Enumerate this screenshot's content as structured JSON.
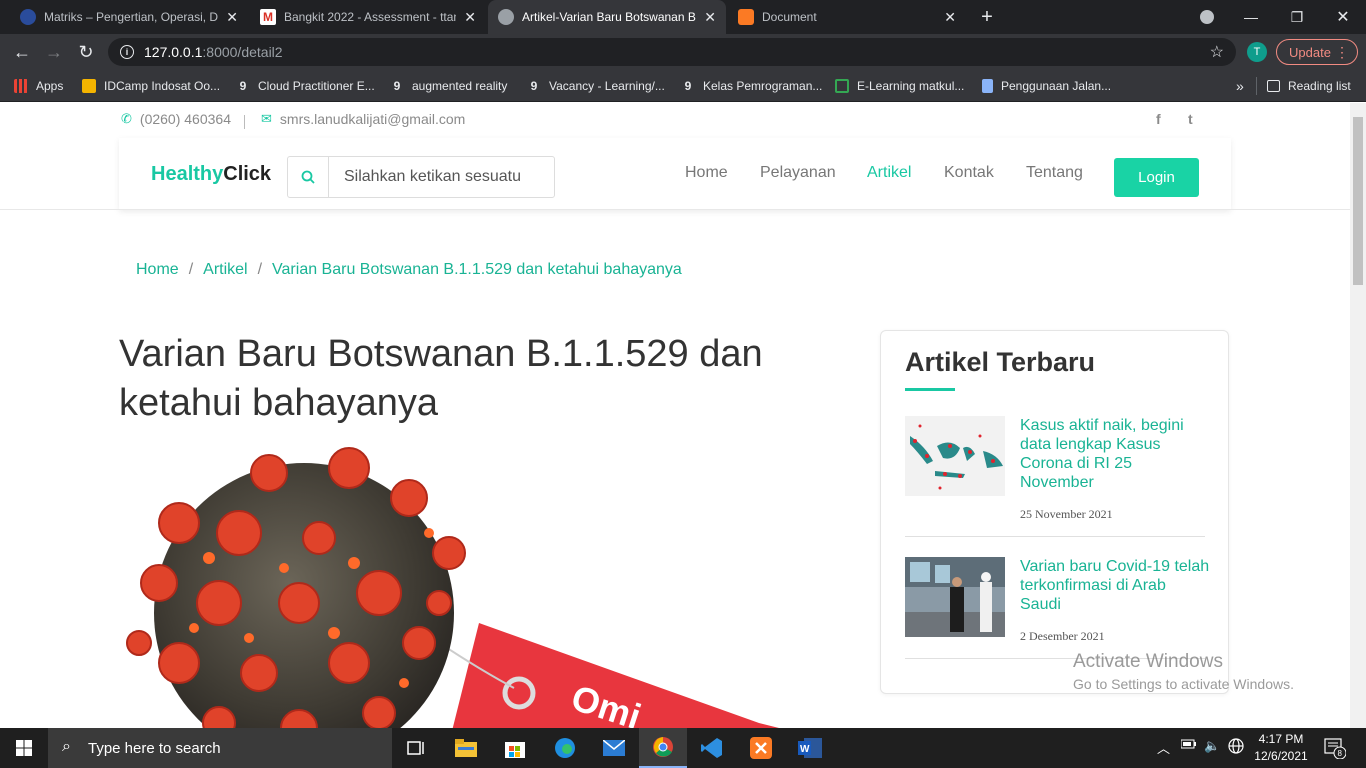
{
  "browser": {
    "tabs": [
      {
        "label": "Matriks – Pengertian, Operasi, De",
        "active": false
      },
      {
        "label": "Bangkit 2022 - Assessment - ttan",
        "active": false
      },
      {
        "label": "Artikel-Varian Baru Botswanan B.",
        "active": true
      },
      {
        "label": "Document",
        "active": false
      }
    ],
    "new_tab": "+",
    "url_host": "127.0.0.1",
    "url_path": ":8000/detail2",
    "profile_initial": "T",
    "update_label": "Update",
    "bookmarks": [
      {
        "label": "Apps",
        "icon": "apps-grid-icon"
      },
      {
        "label": "IDCamp Indosat Oo...",
        "icon": "idcamp-icon"
      },
      {
        "label": "Cloud Practitioner E...",
        "icon": "dicoding-icon"
      },
      {
        "label": "augmented reality",
        "icon": "dicoding-icon"
      },
      {
        "label": "Vacancy - Learning/...",
        "icon": "dicoding-icon"
      },
      {
        "label": "Kelas Pemrograman...",
        "icon": "dicoding-icon"
      },
      {
        "label": "E-Learning matkul...",
        "icon": "elearning-icon"
      },
      {
        "label": "Penggunaan Jalan...",
        "icon": "doc-icon"
      }
    ],
    "more_bookmarks": "»",
    "reading_list": "Reading list"
  },
  "site": {
    "phone": "(0260) 460364",
    "email": "smrs.lanudkalijati@gmail.com",
    "logo_part1": "Healthy",
    "logo_part2": "Click",
    "search_placeholder": "Silahkan ketikan sesuatu",
    "menu": [
      {
        "label": "Home",
        "active": false
      },
      {
        "label": "Pelayanan",
        "active": false
      },
      {
        "label": "Artikel",
        "active": true
      },
      {
        "label": "Kontak",
        "active": false
      },
      {
        "label": "Tentang",
        "active": false
      }
    ],
    "login_label": "Login",
    "social": [
      "f",
      "t"
    ]
  },
  "breadcrumb": {
    "items": [
      "Home",
      "Artikel",
      "Varian Baru Botswanan B.1.1.529 dan ketahui bahayanya"
    ],
    "separator": "/"
  },
  "article": {
    "title_line1": "Varian Baru Botswanan B.1.1.529 dan",
    "title_line2": "ketahui bahayanya",
    "tag_text": "Omi"
  },
  "sidebar": {
    "heading": "Artikel Terbaru",
    "posts": [
      {
        "title": "Kasus aktif naik, begini data lengkap Kasus Corona di RI 25 November",
        "date": "25 November 2021"
      },
      {
        "title": "Varian baru Covid-19 telah terkonfirmasi di Arab Saudi",
        "date": "2 Desember 2021"
      }
    ]
  },
  "watermark": {
    "line1": "Activate Windows",
    "line2": "Go to Settings to activate Windows."
  },
  "taskbar": {
    "search_placeholder": "Type here to search",
    "time": "4:17 PM",
    "date": "12/6/2021",
    "notification_count": "8"
  },
  "colors": {
    "accent": "#19c8a3",
    "login_bg": "#19d3a5",
    "chrome_dark": "#202124",
    "chrome_mid": "#35363a"
  }
}
